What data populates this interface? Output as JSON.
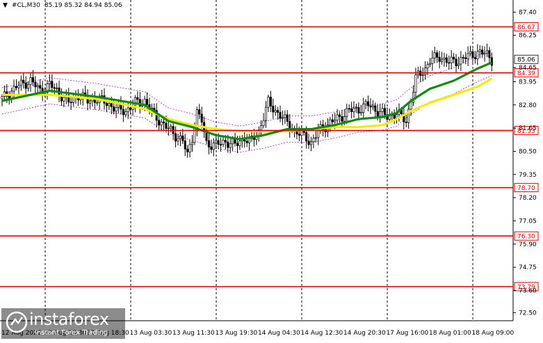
{
  "header": {
    "arrow": "▼",
    "symbol": "#CL,M30",
    "ohlc": "85.19 85.32 84.94 85.06"
  },
  "watermark": {
    "brand": "instaforex",
    "tagline": "Instant Forex Trading",
    "icon": "instaforex-logo-icon"
  },
  "chart_data": {
    "type": "candlestick",
    "y_axis": {
      "ylim": [
        72.1,
        88.0
      ],
      "tick_labels": [
        "87.40",
        "86.25",
        "84.65",
        "83.95",
        "82.80",
        "81.65",
        "80.50",
        "79.35",
        "78.20",
        "77.05",
        "75.90",
        "74.75",
        "73.60",
        "72.50"
      ]
    },
    "x_axis": {
      "tick_labels": [
        "12 Aug 2022",
        "12 Aug 10:30",
        "12 Aug 18:30",
        "13 Aug 03:30",
        "13 Aug 11:30",
        "13 Aug 19:30",
        "14 Aug 04:30",
        "14 Aug 12:30",
        "14 Aug 20:30",
        "17 Aug 16:00",
        "18 Aug 01:00",
        "18 Aug 09:00"
      ],
      "separators": [
        1,
        3,
        5,
        7,
        9,
        11
      ]
    },
    "level_lines": [
      {
        "value": 86.67,
        "label": "86.67",
        "color": "#e00000"
      },
      {
        "value": 84.39,
        "label": "84.39",
        "color": "#e00000"
      },
      {
        "value": 81.53,
        "label": "81.53",
        "color": "#e00000"
      },
      {
        "value": 78.7,
        "label": "78.70",
        "color": "#e00000"
      },
      {
        "value": 76.3,
        "label": "76.30",
        "color": "#e00000"
      },
      {
        "value": 73.79,
        "label": "73.79",
        "color": "#e00000"
      }
    ],
    "current_price": {
      "value": 85.06,
      "label": "85.06"
    },
    "price_path": [
      [
        0,
        83.1
      ],
      [
        6,
        83.7
      ],
      [
        12,
        84.0
      ],
      [
        16,
        83.5
      ],
      [
        20,
        83.8
      ],
      [
        24,
        83.4
      ],
      [
        28,
        82.9
      ],
      [
        32,
        83.3
      ],
      [
        36,
        83.0
      ],
      [
        40,
        83.1
      ],
      [
        44,
        82.9
      ],
      [
        48,
        82.6
      ],
      [
        52,
        82.5
      ],
      [
        56,
        82.9
      ],
      [
        60,
        83.0
      ],
      [
        64,
        82.3
      ],
      [
        68,
        81.8
      ],
      [
        72,
        81.4
      ],
      [
        76,
        81.0
      ],
      [
        78,
        80.3
      ],
      [
        80,
        81.2
      ],
      [
        82,
        82.4
      ],
      [
        84,
        82.0
      ],
      [
        86,
        80.9
      ],
      [
        90,
        80.8
      ],
      [
        94,
        81.0
      ],
      [
        98,
        80.8
      ],
      [
        102,
        81.2
      ],
      [
        104,
        80.9
      ],
      [
        108,
        81.5
      ],
      [
        112,
        82.9
      ],
      [
        116,
        82.4
      ],
      [
        120,
        81.9
      ],
      [
        124,
        81.4
      ],
      [
        128,
        81.2
      ],
      [
        130,
        80.9
      ],
      [
        134,
        81.6
      ],
      [
        138,
        81.9
      ],
      [
        142,
        82.2
      ],
      [
        146,
        82.5
      ],
      [
        150,
        82.6
      ],
      [
        154,
        82.8
      ],
      [
        158,
        82.5
      ],
      [
        162,
        82.2
      ],
      [
        166,
        82.4
      ],
      [
        170,
        82.0
      ],
      [
        174,
        84.1
      ],
      [
        178,
        84.6
      ],
      [
        180,
        85.0
      ],
      [
        184,
        85.2
      ],
      [
        188,
        84.9
      ],
      [
        192,
        85.0
      ],
      [
        196,
        85.2
      ],
      [
        200,
        85.4
      ],
      [
        204,
        85.3
      ],
      [
        206,
        85.06
      ]
    ],
    "ma_fast": {
      "color": "#128a12",
      "points": [
        [
          0,
          83.0
        ],
        [
          20,
          83.5
        ],
        [
          40,
          83.2
        ],
        [
          60,
          82.8
        ],
        [
          70,
          82.0
        ],
        [
          80,
          81.7
        ],
        [
          90,
          81.3
        ],
        [
          100,
          81.1
        ],
        [
          110,
          81.3
        ],
        [
          120,
          81.6
        ],
        [
          130,
          81.6
        ],
        [
          140,
          81.8
        ],
        [
          150,
          82.1
        ],
        [
          160,
          82.2
        ],
        [
          166,
          82.4
        ],
        [
          172,
          83.0
        ],
        [
          180,
          83.6
        ],
        [
          190,
          84.0
        ],
        [
          200,
          84.6
        ],
        [
          206,
          84.9
        ]
      ]
    },
    "ma_slow": {
      "color": "#f5eb00",
      "points": [
        [
          0,
          83.3
        ],
        [
          20,
          83.3
        ],
        [
          40,
          83.1
        ],
        [
          60,
          82.6
        ],
        [
          70,
          82.1
        ],
        [
          80,
          81.8
        ],
        [
          90,
          81.6
        ],
        [
          100,
          81.5
        ],
        [
          110,
          81.5
        ],
        [
          120,
          81.5
        ],
        [
          130,
          81.6
        ],
        [
          140,
          81.7
        ],
        [
          150,
          81.7
        ],
        [
          160,
          81.8
        ],
        [
          166,
          82.1
        ],
        [
          172,
          82.5
        ],
        [
          180,
          82.9
        ],
        [
          190,
          83.3
        ],
        [
          200,
          83.7
        ],
        [
          206,
          84.1
        ]
      ]
    },
    "envelope_offset": 0.65
  }
}
